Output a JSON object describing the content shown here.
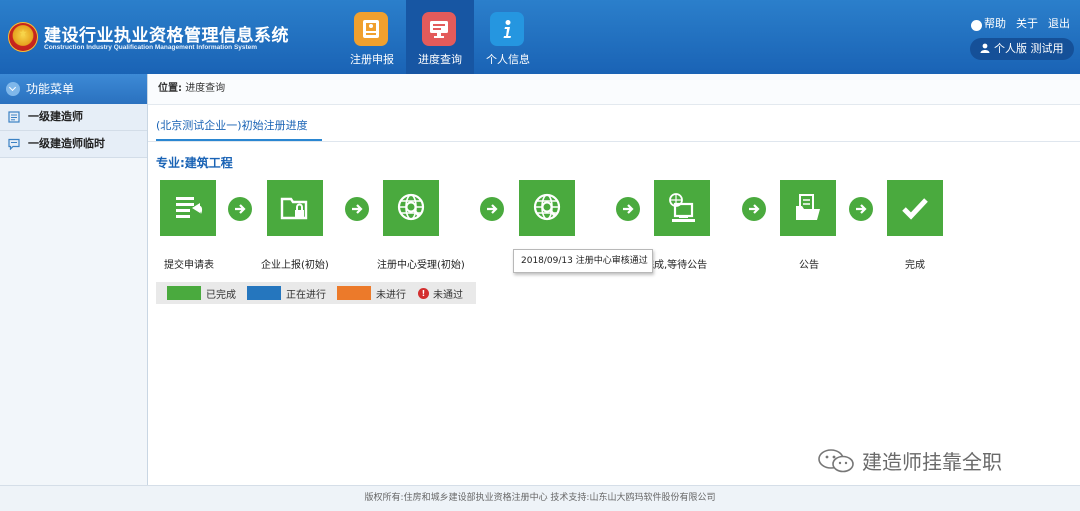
{
  "header": {
    "title": "建设行业执业资格管理信息系统",
    "subtitle": "Construction Industry Qualification Management Information System",
    "nav": [
      {
        "label": "注册申报",
        "icon": "id-card-icon",
        "color": "#f0a02e"
      },
      {
        "label": "进度查询",
        "icon": "monitor-icon",
        "color": "#e35b5b"
      },
      {
        "label": "个人信息",
        "icon": "info-icon",
        "color": "#2596e0"
      }
    ],
    "links": {
      "help": "帮助",
      "about": "关于",
      "logout": "退出"
    },
    "user": "个人版  测试用"
  },
  "sidebar": {
    "title": "功能菜单",
    "items": [
      {
        "label": "一级建造师",
        "icon": "document-icon"
      },
      {
        "label": "一级建造师临时",
        "icon": "chat-icon"
      }
    ]
  },
  "main": {
    "breadcrumb_label": "位置:",
    "breadcrumb_value": "进度查询",
    "tab": "(北京测试企业一)初始注册进度",
    "specialty": "专业:建筑工程",
    "steps": [
      {
        "label": "提交申请表",
        "icon": "submit-doc-icon",
        "status": "done"
      },
      {
        "label": "企业上报(初始)",
        "icon": "locked-folder-icon",
        "status": "done"
      },
      {
        "label": "注册中心受理(初始)",
        "icon": "globe-search-icon",
        "status": "done"
      },
      {
        "label": "",
        "icon": "globe-search-icon",
        "status": "done"
      },
      {
        "label": "审查完成,等待公告",
        "icon": "computer-globe-icon",
        "status": "done"
      },
      {
        "label": "公告",
        "icon": "documents-folder-icon",
        "status": "done"
      },
      {
        "label": "完成",
        "icon": "checkmark-icon",
        "status": "done"
      }
    ],
    "tooltip": "2018/09/13 注册中心审核通过",
    "legend": [
      {
        "label": "已完成",
        "color": "#4aaa3e"
      },
      {
        "label": "正在进行",
        "color": "#2576be"
      },
      {
        "label": "未进行",
        "color": "#ec7a2a"
      },
      {
        "label": "未通过",
        "color": "#d32f2f"
      }
    ]
  },
  "watermark": "建造师挂靠全职",
  "footer": "版权所有:住房和城乡建设部执业资格注册中心   技术支持:山东山大鸥玛软件股份有限公司"
}
